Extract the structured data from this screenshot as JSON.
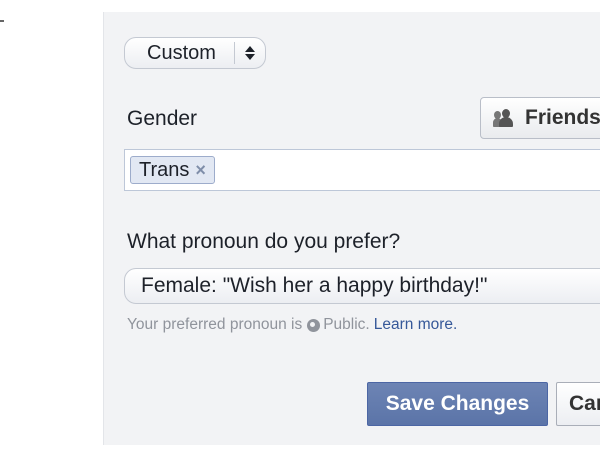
{
  "custom_select": {
    "value": "Custom"
  },
  "gender": {
    "label": "Gender",
    "audience_label": "Friends",
    "tokens": [
      {
        "label": "Trans",
        "remove_symbol": "×"
      }
    ]
  },
  "pronoun": {
    "question": "What pronoun do you prefer?",
    "selected": "Female: \"Wish her a happy birthday!\"",
    "helper_prefix": "Your preferred pronoun is",
    "helper_visibility": "Public.",
    "learn_more": "Learn more."
  },
  "actions": {
    "save_label": "Save Changes",
    "cancel_label": "Cancel"
  },
  "colors": {
    "primary": "#5b74a8",
    "link": "#365899",
    "panel_bg": "#f2f3f5"
  },
  "icons": [
    "select-arrows-icon",
    "friends-icon",
    "remove-icon",
    "globe-icon"
  ]
}
